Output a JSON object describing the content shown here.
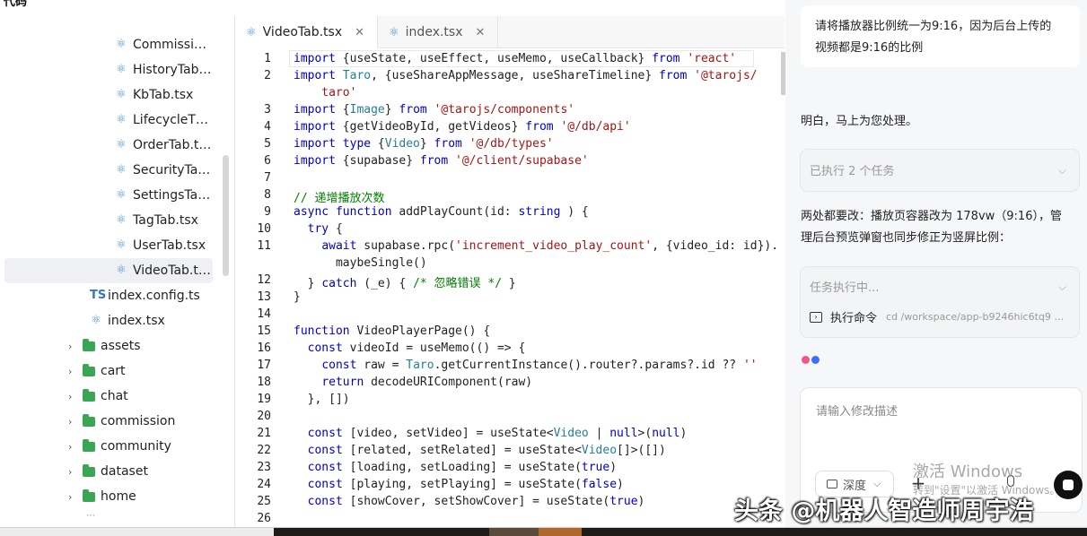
{
  "header": {
    "title_fragment": "代码"
  },
  "sidebar": {
    "files": [
      {
        "name": "Commissi…",
        "type": "react"
      },
      {
        "name": "HistoryTab…",
        "type": "react"
      },
      {
        "name": "KbTab.tsx",
        "type": "react"
      },
      {
        "name": "LifecycleT…",
        "type": "react"
      },
      {
        "name": "OrderTab.t…",
        "type": "react"
      },
      {
        "name": "SecurityTa…",
        "type": "react"
      },
      {
        "name": "SettingsTa…",
        "type": "react"
      },
      {
        "name": "TagTab.tsx",
        "type": "react"
      },
      {
        "name": "UserTab.tsx",
        "type": "react"
      },
      {
        "name": "VideoTab.t…",
        "type": "react",
        "selected": true
      }
    ],
    "root_files": [
      {
        "name": "index.config.ts",
        "type": "ts",
        "icon_text": "TS"
      },
      {
        "name": "index.tsx",
        "type": "react"
      }
    ],
    "folders": [
      "assets",
      "cart",
      "chat",
      "commission",
      "community",
      "dataset",
      "home"
    ]
  },
  "editor": {
    "tabs": [
      {
        "label": "VideoTab.tsx",
        "active": true
      },
      {
        "label": "index.tsx",
        "active": false
      }
    ],
    "close_glyph": "✕",
    "lines": [
      {
        "n": "1",
        "tokens": [
          [
            "kw",
            "import "
          ],
          [
            "",
            "{useState, useEffect, useMemo, useCallback} "
          ],
          [
            "kw",
            "from "
          ],
          [
            "str",
            "'react'"
          ]
        ]
      },
      {
        "n": "2",
        "tokens": [
          [
            "kw",
            "import "
          ],
          [
            "ty",
            "Taro"
          ],
          [
            "",
            ", {useShareAppMessage, useShareTimeline} "
          ],
          [
            "kw",
            "from "
          ],
          [
            "str",
            "'@tarojs/"
          ]
        ]
      },
      {
        "n": "",
        "tokens": [
          [
            "str",
            "    taro'"
          ]
        ]
      },
      {
        "n": "3",
        "tokens": [
          [
            "kw",
            "import "
          ],
          [
            "",
            "{"
          ],
          [
            "ty",
            "Image"
          ],
          [
            "",
            "} "
          ],
          [
            "kw",
            "from "
          ],
          [
            "str",
            "'@tarojs/components'"
          ]
        ]
      },
      {
        "n": "4",
        "tokens": [
          [
            "kw",
            "import "
          ],
          [
            "",
            "{getVideoById, getVideos} "
          ],
          [
            "kw",
            "from "
          ],
          [
            "str",
            "'@/db/api'"
          ]
        ]
      },
      {
        "n": "5",
        "tokens": [
          [
            "kw",
            "import type "
          ],
          [
            "",
            "{"
          ],
          [
            "ty",
            "Video"
          ],
          [
            "",
            "} "
          ],
          [
            "kw",
            "from "
          ],
          [
            "str",
            "'@/db/types'"
          ]
        ]
      },
      {
        "n": "6",
        "tokens": [
          [
            "kw",
            "import "
          ],
          [
            "",
            "{supabase} "
          ],
          [
            "kw",
            "from "
          ],
          [
            "str",
            "'@/client/supabase'"
          ]
        ]
      },
      {
        "n": "7",
        "tokens": []
      },
      {
        "n": "8",
        "tokens": [
          [
            "cm",
            "// 递增播放次数"
          ]
        ]
      },
      {
        "n": "9",
        "tokens": [
          [
            "kw",
            "async function "
          ],
          [
            "",
            "addPlayCount(id: "
          ],
          [
            "kw",
            "string"
          ],
          [
            "",
            " ) {"
          ]
        ]
      },
      {
        "n": "10",
        "tokens": [
          [
            "",
            "  "
          ],
          [
            "kw",
            "try "
          ],
          [
            "",
            "{"
          ]
        ]
      },
      {
        "n": "11",
        "tokens": [
          [
            "",
            "    "
          ],
          [
            "kw",
            "await "
          ],
          [
            "",
            "supabase.rpc("
          ],
          [
            "str",
            "'increment_video_play_count'"
          ],
          [
            "",
            ", {video_id: id})."
          ]
        ]
      },
      {
        "n": "",
        "tokens": [
          [
            "",
            "      maybeSingle()"
          ]
        ]
      },
      {
        "n": "12",
        "tokens": [
          [
            "",
            "  } "
          ],
          [
            "kw",
            "catch "
          ],
          [
            "",
            "(_e) { "
          ],
          [
            "cm",
            "/* 忽略错误 */"
          ],
          [
            "",
            " }"
          ]
        ]
      },
      {
        "n": "13",
        "tokens": [
          [
            "",
            "}"
          ]
        ]
      },
      {
        "n": "14",
        "tokens": []
      },
      {
        "n": "15",
        "tokens": [
          [
            "kw",
            "function "
          ],
          [
            "",
            "VideoPlayerPage() {"
          ]
        ]
      },
      {
        "n": "16",
        "tokens": [
          [
            "",
            "  "
          ],
          [
            "kw",
            "const "
          ],
          [
            "",
            "videoId = useMemo(() => {"
          ]
        ]
      },
      {
        "n": "17",
        "tokens": [
          [
            "",
            "    "
          ],
          [
            "kw",
            "const "
          ],
          [
            "",
            "raw = "
          ],
          [
            "ty",
            "Taro"
          ],
          [
            "",
            ".getCurrentInstance().router?.params?.id ?? "
          ],
          [
            "str",
            "''"
          ]
        ]
      },
      {
        "n": "18",
        "tokens": [
          [
            "",
            "    "
          ],
          [
            "kw",
            "return "
          ],
          [
            "",
            "decodeURIComponent(raw)"
          ]
        ]
      },
      {
        "n": "19",
        "tokens": [
          [
            "",
            "  }, [])"
          ]
        ]
      },
      {
        "n": "20",
        "tokens": []
      },
      {
        "n": "21",
        "tokens": [
          [
            "",
            "  "
          ],
          [
            "kw",
            "const "
          ],
          [
            "",
            "[video, setVideo] = useState<"
          ],
          [
            "ty",
            "Video"
          ],
          [
            "",
            " | "
          ],
          [
            "kw",
            "null"
          ],
          [
            "",
            ">("
          ],
          [
            "kw",
            "null"
          ],
          [
            "",
            ")"
          ]
        ]
      },
      {
        "n": "22",
        "tokens": [
          [
            "",
            "  "
          ],
          [
            "kw",
            "const "
          ],
          [
            "",
            "[related, setRelated] = useState<"
          ],
          [
            "ty",
            "Video"
          ],
          [
            "",
            "[]>([])"
          ]
        ]
      },
      {
        "n": "23",
        "tokens": [
          [
            "",
            "  "
          ],
          [
            "kw",
            "const "
          ],
          [
            "",
            "[loading, setLoading] = useState("
          ],
          [
            "kw",
            "true"
          ],
          [
            "",
            ")"
          ]
        ]
      },
      {
        "n": "24",
        "tokens": [
          [
            "",
            "  "
          ],
          [
            "kw",
            "const "
          ],
          [
            "",
            "[playing, setPlaying] = useState("
          ],
          [
            "kw",
            "false"
          ],
          [
            "",
            ")"
          ]
        ]
      },
      {
        "n": "25",
        "tokens": [
          [
            "",
            "  "
          ],
          [
            "kw",
            "const "
          ],
          [
            "",
            "[showCover, setShowCover] = useState("
          ],
          [
            "kw",
            "true"
          ],
          [
            "",
            ")"
          ]
        ]
      },
      {
        "n": "26",
        "tokens": []
      }
    ]
  },
  "chat": {
    "user_message_lines": [
      "请将播放器比例统一为9:16，因为后台上传的",
      "视频都是9:16的比例"
    ],
    "reply_1": "明白，马上为您处理。",
    "task_card_1": "已执行 2 个任务",
    "reply_2_lines": [
      "两处都要改：播放页容器改为 178vw（9:16），管",
      "理后台预览弹窗也同步修正为竖屏比例："
    ],
    "task_card_2": {
      "status": "任务执行中...",
      "command_label": "执行命令",
      "command_text": "cd /workspace/app-b9246hic6tq9 …"
    },
    "input_placeholder": "请输入修改描述",
    "depth_label": "深度",
    "dot_colors": [
      "#f2558c",
      "#3b6ff5"
    ]
  },
  "overlay": {
    "windows_activate_title": "激活 Windows",
    "windows_activate_sub": "转到\"设置\"以激活 Windows。",
    "watermark": "头条 @机器人智造师周宇浩"
  }
}
